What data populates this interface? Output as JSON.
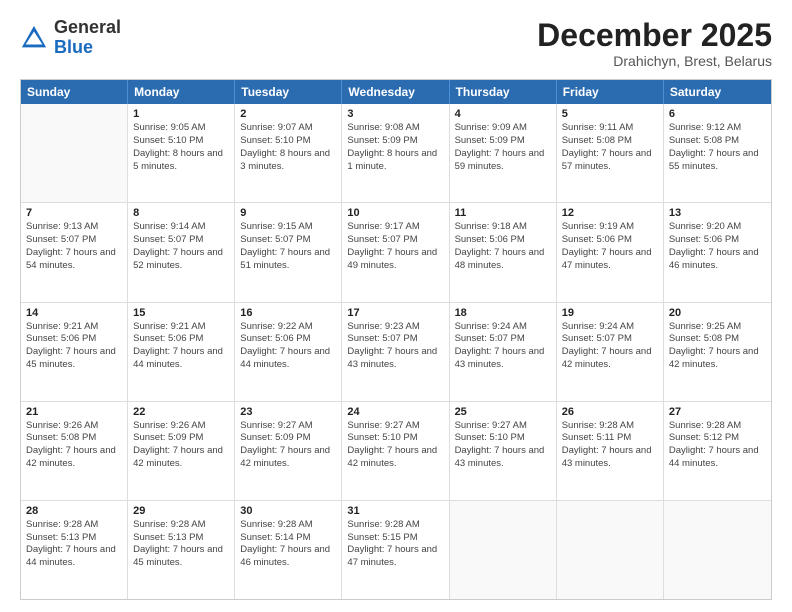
{
  "header": {
    "logo_general": "General",
    "logo_blue": "Blue",
    "month_title": "December 2025",
    "location": "Drahichyn, Brest, Belarus"
  },
  "weekdays": [
    "Sunday",
    "Monday",
    "Tuesday",
    "Wednesday",
    "Thursday",
    "Friday",
    "Saturday"
  ],
  "weeks": [
    [
      {
        "day": "",
        "sunrise": "",
        "sunset": "",
        "daylight": ""
      },
      {
        "day": "1",
        "sunrise": "Sunrise: 9:05 AM",
        "sunset": "Sunset: 5:10 PM",
        "daylight": "Daylight: 8 hours and 5 minutes."
      },
      {
        "day": "2",
        "sunrise": "Sunrise: 9:07 AM",
        "sunset": "Sunset: 5:10 PM",
        "daylight": "Daylight: 8 hours and 3 minutes."
      },
      {
        "day": "3",
        "sunrise": "Sunrise: 9:08 AM",
        "sunset": "Sunset: 5:09 PM",
        "daylight": "Daylight: 8 hours and 1 minute."
      },
      {
        "day": "4",
        "sunrise": "Sunrise: 9:09 AM",
        "sunset": "Sunset: 5:09 PM",
        "daylight": "Daylight: 7 hours and 59 minutes."
      },
      {
        "day": "5",
        "sunrise": "Sunrise: 9:11 AM",
        "sunset": "Sunset: 5:08 PM",
        "daylight": "Daylight: 7 hours and 57 minutes."
      },
      {
        "day": "6",
        "sunrise": "Sunrise: 9:12 AM",
        "sunset": "Sunset: 5:08 PM",
        "daylight": "Daylight: 7 hours and 55 minutes."
      }
    ],
    [
      {
        "day": "7",
        "sunrise": "Sunrise: 9:13 AM",
        "sunset": "Sunset: 5:07 PM",
        "daylight": "Daylight: 7 hours and 54 minutes."
      },
      {
        "day": "8",
        "sunrise": "Sunrise: 9:14 AM",
        "sunset": "Sunset: 5:07 PM",
        "daylight": "Daylight: 7 hours and 52 minutes."
      },
      {
        "day": "9",
        "sunrise": "Sunrise: 9:15 AM",
        "sunset": "Sunset: 5:07 PM",
        "daylight": "Daylight: 7 hours and 51 minutes."
      },
      {
        "day": "10",
        "sunrise": "Sunrise: 9:17 AM",
        "sunset": "Sunset: 5:07 PM",
        "daylight": "Daylight: 7 hours and 49 minutes."
      },
      {
        "day": "11",
        "sunrise": "Sunrise: 9:18 AM",
        "sunset": "Sunset: 5:06 PM",
        "daylight": "Daylight: 7 hours and 48 minutes."
      },
      {
        "day": "12",
        "sunrise": "Sunrise: 9:19 AM",
        "sunset": "Sunset: 5:06 PM",
        "daylight": "Daylight: 7 hours and 47 minutes."
      },
      {
        "day": "13",
        "sunrise": "Sunrise: 9:20 AM",
        "sunset": "Sunset: 5:06 PM",
        "daylight": "Daylight: 7 hours and 46 minutes."
      }
    ],
    [
      {
        "day": "14",
        "sunrise": "Sunrise: 9:21 AM",
        "sunset": "Sunset: 5:06 PM",
        "daylight": "Daylight: 7 hours and 45 minutes."
      },
      {
        "day": "15",
        "sunrise": "Sunrise: 9:21 AM",
        "sunset": "Sunset: 5:06 PM",
        "daylight": "Daylight: 7 hours and 44 minutes."
      },
      {
        "day": "16",
        "sunrise": "Sunrise: 9:22 AM",
        "sunset": "Sunset: 5:06 PM",
        "daylight": "Daylight: 7 hours and 44 minutes."
      },
      {
        "day": "17",
        "sunrise": "Sunrise: 9:23 AM",
        "sunset": "Sunset: 5:07 PM",
        "daylight": "Daylight: 7 hours and 43 minutes."
      },
      {
        "day": "18",
        "sunrise": "Sunrise: 9:24 AM",
        "sunset": "Sunset: 5:07 PM",
        "daylight": "Daylight: 7 hours and 43 minutes."
      },
      {
        "day": "19",
        "sunrise": "Sunrise: 9:24 AM",
        "sunset": "Sunset: 5:07 PM",
        "daylight": "Daylight: 7 hours and 42 minutes."
      },
      {
        "day": "20",
        "sunrise": "Sunrise: 9:25 AM",
        "sunset": "Sunset: 5:08 PM",
        "daylight": "Daylight: 7 hours and 42 minutes."
      }
    ],
    [
      {
        "day": "21",
        "sunrise": "Sunrise: 9:26 AM",
        "sunset": "Sunset: 5:08 PM",
        "daylight": "Daylight: 7 hours and 42 minutes."
      },
      {
        "day": "22",
        "sunrise": "Sunrise: 9:26 AM",
        "sunset": "Sunset: 5:09 PM",
        "daylight": "Daylight: 7 hours and 42 minutes."
      },
      {
        "day": "23",
        "sunrise": "Sunrise: 9:27 AM",
        "sunset": "Sunset: 5:09 PM",
        "daylight": "Daylight: 7 hours and 42 minutes."
      },
      {
        "day": "24",
        "sunrise": "Sunrise: 9:27 AM",
        "sunset": "Sunset: 5:10 PM",
        "daylight": "Daylight: 7 hours and 42 minutes."
      },
      {
        "day": "25",
        "sunrise": "Sunrise: 9:27 AM",
        "sunset": "Sunset: 5:10 PM",
        "daylight": "Daylight: 7 hours and 43 minutes."
      },
      {
        "day": "26",
        "sunrise": "Sunrise: 9:28 AM",
        "sunset": "Sunset: 5:11 PM",
        "daylight": "Daylight: 7 hours and 43 minutes."
      },
      {
        "day": "27",
        "sunrise": "Sunrise: 9:28 AM",
        "sunset": "Sunset: 5:12 PM",
        "daylight": "Daylight: 7 hours and 44 minutes."
      }
    ],
    [
      {
        "day": "28",
        "sunrise": "Sunrise: 9:28 AM",
        "sunset": "Sunset: 5:13 PM",
        "daylight": "Daylight: 7 hours and 44 minutes."
      },
      {
        "day": "29",
        "sunrise": "Sunrise: 9:28 AM",
        "sunset": "Sunset: 5:13 PM",
        "daylight": "Daylight: 7 hours and 45 minutes."
      },
      {
        "day": "30",
        "sunrise": "Sunrise: 9:28 AM",
        "sunset": "Sunset: 5:14 PM",
        "daylight": "Daylight: 7 hours and 46 minutes."
      },
      {
        "day": "31",
        "sunrise": "Sunrise: 9:28 AM",
        "sunset": "Sunset: 5:15 PM",
        "daylight": "Daylight: 7 hours and 47 minutes."
      },
      {
        "day": "",
        "sunrise": "",
        "sunset": "",
        "daylight": ""
      },
      {
        "day": "",
        "sunrise": "",
        "sunset": "",
        "daylight": ""
      },
      {
        "day": "",
        "sunrise": "",
        "sunset": "",
        "daylight": ""
      }
    ]
  ]
}
